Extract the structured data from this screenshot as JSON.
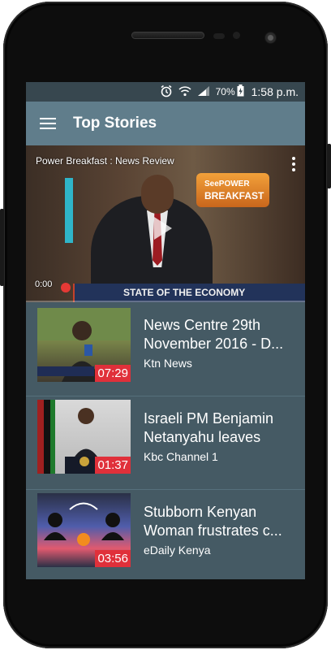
{
  "status": {
    "battery": "70%",
    "time": "1:58 p.m."
  },
  "appbar": {
    "title": "Top Stories"
  },
  "player": {
    "video_title": "Power Breakfast : News Review",
    "elapsed": "0:00",
    "banner_line1": "SeePOWER",
    "banner_line2": "BREAKFAST",
    "ticker_text": "STATE OF THE ECONOMY"
  },
  "videos": [
    {
      "title": "News Centre 29th November 2016 - D...",
      "channel": "Ktn News",
      "duration": "07:29"
    },
    {
      "title": "Israeli PM Benjamin Netanyahu leaves",
      "channel": "Kbc Channel 1",
      "duration": "01:37"
    },
    {
      "title": "Stubborn Kenyan Woman frustrates c...",
      "channel": "eDaily Kenya",
      "duration": "03:56"
    }
  ],
  "colors": {
    "appbar": "#607d8b",
    "statusbar": "#37474f",
    "list_bg": "#455a64",
    "duration_badge": "#e0303a"
  }
}
